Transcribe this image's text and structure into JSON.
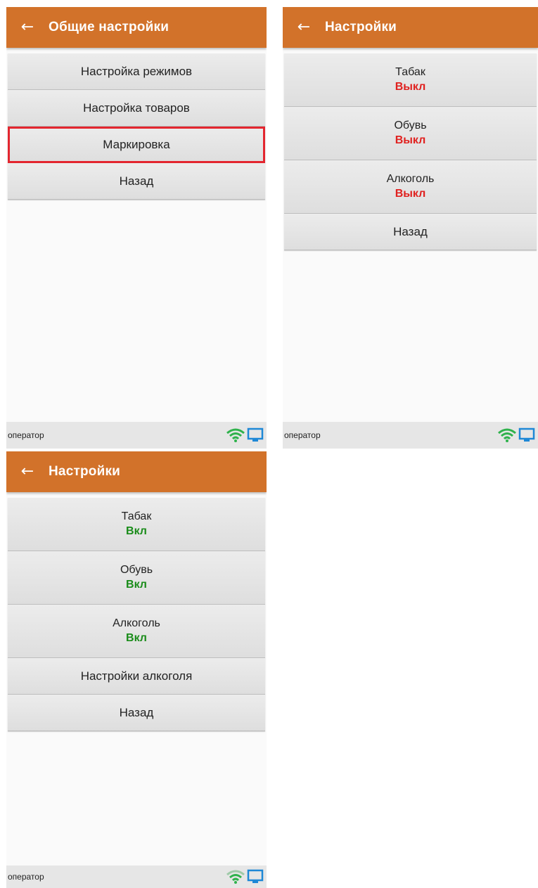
{
  "screens": [
    {
      "title": "Общие настройки",
      "items": [
        {
          "label": "Настройка режимов"
        },
        {
          "label": "Настройка товаров"
        },
        {
          "label": "Маркировка"
        },
        {
          "label": "Назад"
        }
      ],
      "status_user": "оператор"
    },
    {
      "title": "Настройки",
      "items": [
        {
          "label": "Табак",
          "state": "Выкл"
        },
        {
          "label": "Обувь",
          "state": "Выкл"
        },
        {
          "label": "Алкоголь",
          "state": "Выкл"
        },
        {
          "label": "Назад"
        }
      ],
      "status_user": "оператор"
    },
    {
      "title": "Настройки",
      "items": [
        {
          "label": "Табак",
          "state": "Вкл"
        },
        {
          "label": "Обувь",
          "state": "Вкл"
        },
        {
          "label": "Алкоголь",
          "state": "Вкл"
        },
        {
          "label": "Настройки алкоголя"
        },
        {
          "label": "Назад"
        }
      ],
      "status_user": "оператор"
    }
  ],
  "icons": {
    "back": "arrow-left-icon",
    "wifi": "wifi-icon",
    "monitor": "monitor-icon"
  },
  "colors": {
    "appbar": "#d2722a",
    "state_off": "#e0211f",
    "state_on": "#1a8c1a",
    "highlight": "#e3262f",
    "wifi": "#2fb24c",
    "monitor": "#1e88d6"
  }
}
